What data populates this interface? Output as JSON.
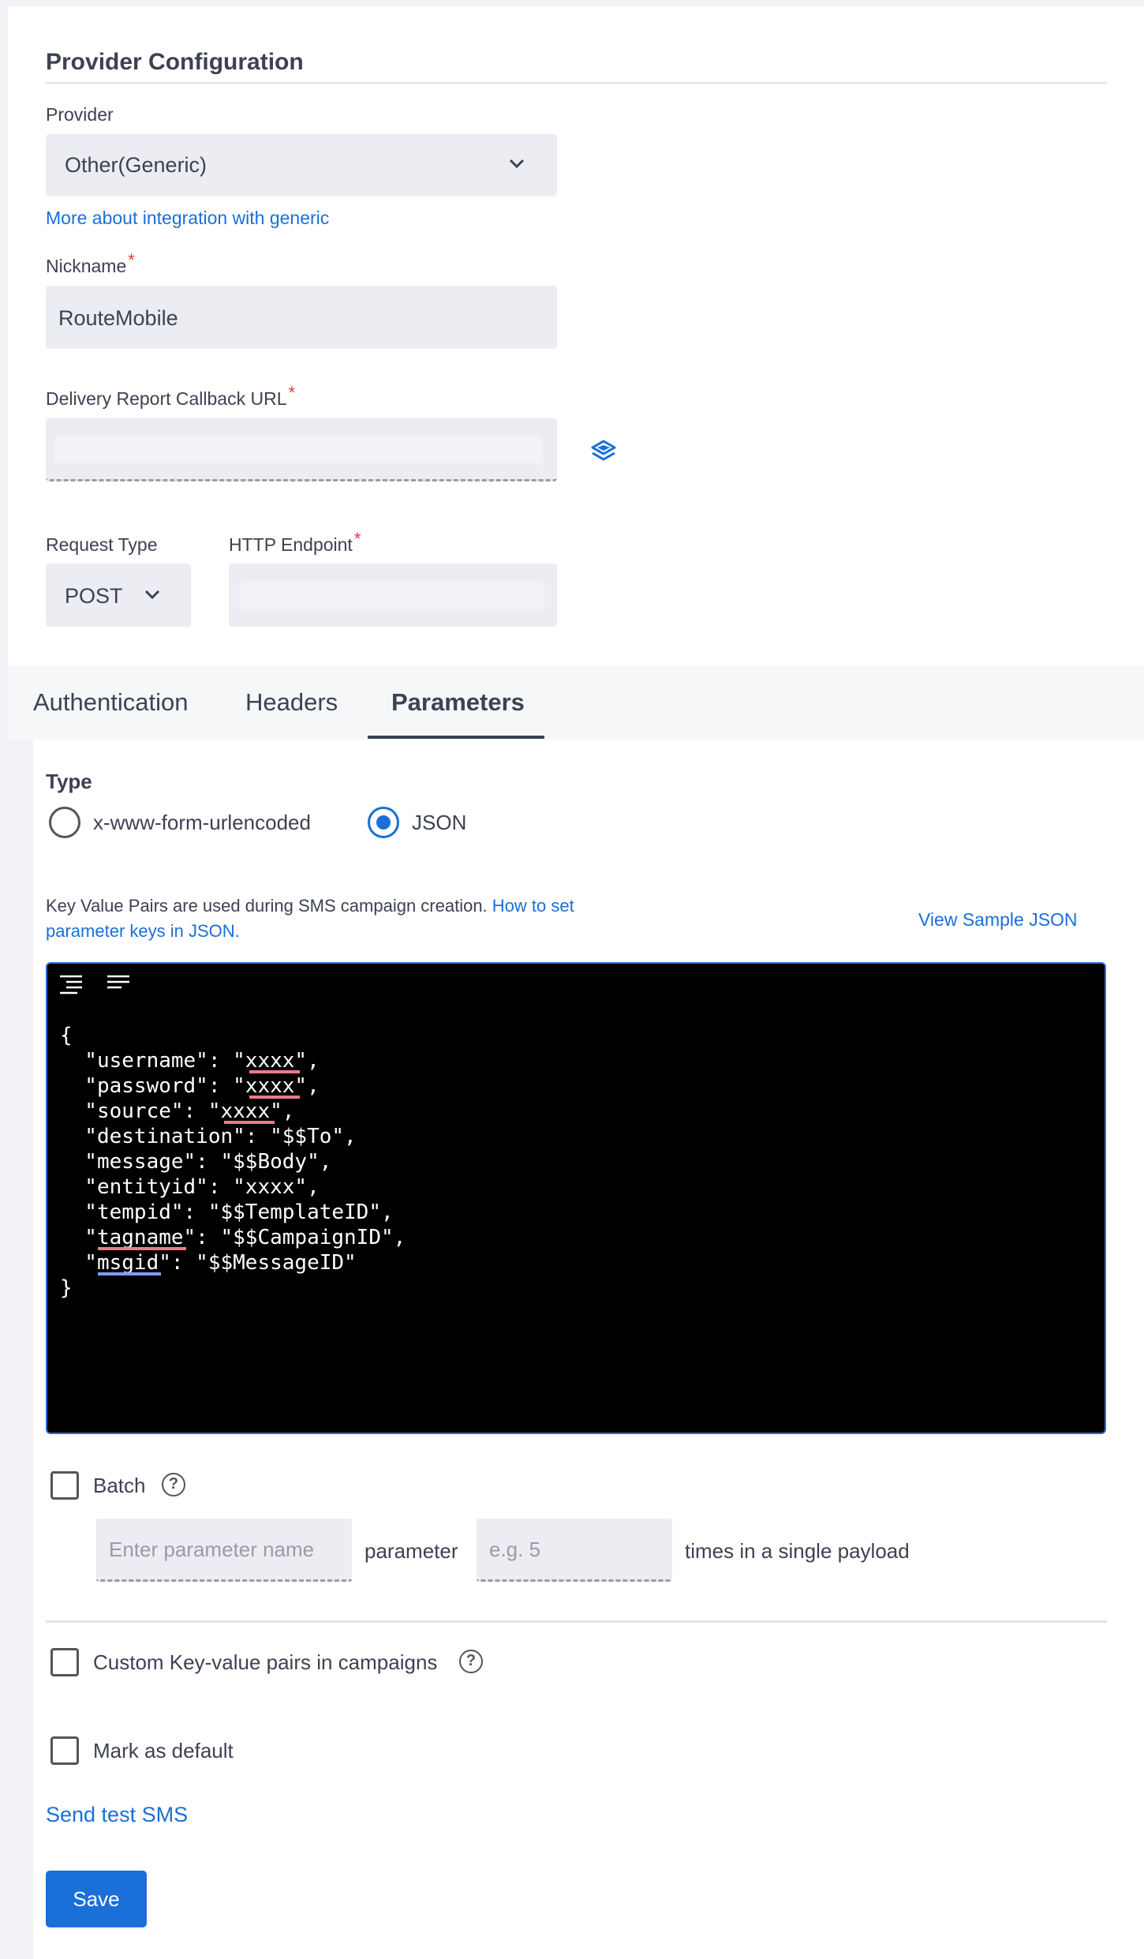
{
  "provider_config": {
    "title": "Provider Configuration",
    "provider_label": "Provider",
    "provider_value": "Other(Generic)",
    "integration_link": "More about integration with generic",
    "nickname_label": "Nickname",
    "nickname_value": "RouteMobile",
    "callback_label": "Delivery Report Callback URL",
    "request_type_label": "Request Type",
    "request_type_value": "POST",
    "endpoint_label": "HTTP Endpoint",
    "required_mark": "*"
  },
  "tabs": [
    {
      "label": "Authentication"
    },
    {
      "label": "Headers"
    },
    {
      "label": "Parameters"
    }
  ],
  "parameters": {
    "type_label": "Type",
    "option_form": "x-www-form-urlencoded",
    "option_json": "JSON",
    "selected": "JSON",
    "info_text": "Key Value Pairs are used during SMS campaign creation.",
    "info_link_1": "How to set",
    "info_link_2": "parameter keys in JSON.",
    "view_sample": "View Sample JSON",
    "code_lines": [
      "{",
      "  \"username\": \"xxxx\",",
      "  \"password\": \"xxxx\",",
      "  \"source\": \"xxxx\",",
      "  \"destination\": \"$$To\",",
      "  \"message\": \"$$Body\",",
      "  \"entityid\": \"xxxx\",",
      "  \"tempid\": \"$$TemplateID\",",
      "  \"tagname\": \"$$CampaignID\",",
      "  \"msgid\": \"$$MessageID\"",
      "}"
    ],
    "batch_label": "Batch",
    "batch_param_placeholder": "Enter parameter name",
    "batch_param_word": "parameter",
    "batch_count_placeholder": "e.g. 5",
    "batch_suffix": "times in a single payload",
    "custom_kv_label": "Custom Key-value pairs in campaigns",
    "default_label": "Mark as default",
    "test_sms_link": "Send test SMS",
    "save_label": "Save",
    "help_glyph": "?"
  }
}
